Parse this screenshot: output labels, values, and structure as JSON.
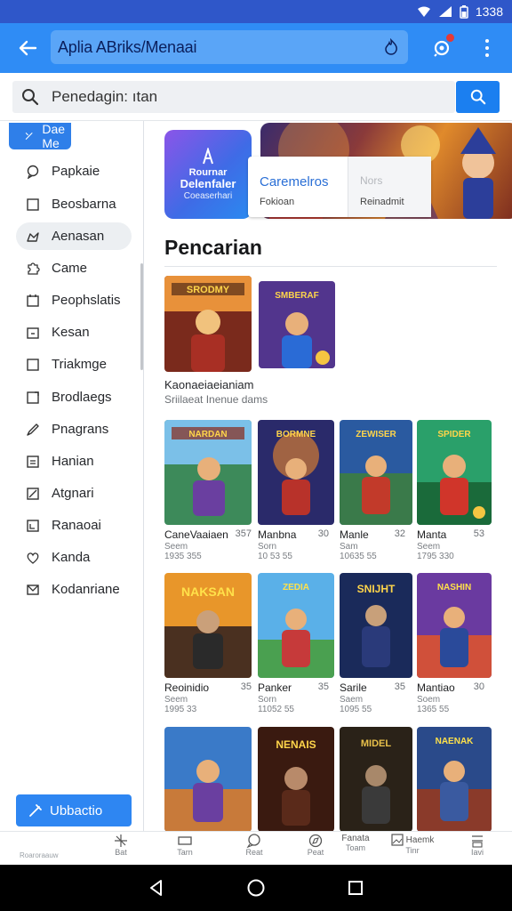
{
  "status_bar": {
    "time": "1338",
    "icons": [
      "wifi-icon",
      "signal-icon",
      "battery-icon"
    ]
  },
  "app_bar": {
    "title": "Aplia ABriks/Menaai",
    "icons": [
      "back-arrow-icon",
      "flame-icon",
      "notification-icon",
      "more-vert-icon"
    ]
  },
  "search": {
    "value": "Penedagin: ıtan",
    "placeholder": "Penedagin: ıtan"
  },
  "sidebar": {
    "top_label": "Dae Me",
    "items": [
      {
        "label": "Papkaie",
        "icon": "chat-bubble-icon"
      },
      {
        "label": "Beosbarna",
        "icon": "square-icon"
      },
      {
        "label": "Aenasan",
        "icon": "cloud-icon",
        "active": true
      },
      {
        "label": "Came",
        "icon": "puzzle-icon"
      },
      {
        "label": "Peophslatis",
        "icon": "calendar-icon"
      },
      {
        "label": "Kesan",
        "icon": "lock-icon"
      },
      {
        "label": "Triakmge",
        "icon": "checkbox-icon"
      },
      {
        "label": "Brodlaegs",
        "icon": "edit-square-icon"
      },
      {
        "label": "Pnagrans",
        "icon": "pen-icon"
      },
      {
        "label": "Hanian",
        "icon": "list-icon"
      },
      {
        "label": "Atgnari",
        "icon": "ruler-icon"
      },
      {
        "label": "Ranaoai",
        "icon": "box-icon"
      },
      {
        "label": "Kanda",
        "icon": "heart-icon"
      },
      {
        "label": "Kodanriane",
        "icon": "mail-icon"
      }
    ],
    "update_button": "Ubbactio"
  },
  "promo": {
    "app_line1": "Rournar",
    "app_line2": "Delenfaler",
    "app_line3": "Coeaserhari",
    "card": {
      "col1_title": "Caremelros",
      "col1_sub": "Fokioan",
      "col2_title": "Nors",
      "col2_sub": "Reinadmit"
    }
  },
  "section": {
    "title": "Pencarian"
  },
  "featured": {
    "caption": "Kaonaeiaeianiam",
    "subcaption": "Sriilaeat Inenue dams",
    "tiles": [
      {
        "title": "SRODMY",
        "accent": "#c0392b"
      },
      {
        "title": "SMBERAF",
        "accent": "#6a3fa0"
      }
    ]
  },
  "grid": [
    {
      "title": "NARDAN",
      "name": "CaneVaaiaen",
      "rating": "357",
      "sub": "Seem",
      "count": "1935 355"
    },
    {
      "title": "BORMNE",
      "name": "Manbna",
      "rating": "30",
      "sub": "Sorn",
      "count": "10 53 55"
    },
    {
      "title": "ZEWISER",
      "name": "Manle",
      "rating": "32",
      "sub": "Sam",
      "count": "10635 55"
    },
    {
      "title": "SPIDER",
      "name": "Manta",
      "rating": "53",
      "sub": "Seem",
      "count": "1795 330"
    },
    {
      "title": "NAKSAN",
      "name": "Reoinidio",
      "rating": "35",
      "sub": "Seem",
      "count": "1995 33"
    },
    {
      "title": "ZEDIA",
      "name": "Panker",
      "rating": "35",
      "sub": "Sorn",
      "count": "11052 55"
    },
    {
      "title": "SNIJHT",
      "name": "Sarile",
      "rating": "35",
      "sub": "Saem",
      "count": "1095 55"
    },
    {
      "title": "NASHIN",
      "name": "Mantiao",
      "rating": "30",
      "sub": "Soem",
      "count": "1365 55"
    },
    {
      "title": "",
      "name": "",
      "rating": "",
      "sub": "",
      "count": ""
    },
    {
      "title": "NENAIS",
      "name": "",
      "rating": "",
      "sub": "",
      "count": ""
    },
    {
      "title": "MIDEL",
      "name": "",
      "rating": "",
      "sub": "",
      "count": ""
    },
    {
      "title": "NAENAK",
      "name": "",
      "rating": "",
      "sub": "",
      "count": ""
    }
  ],
  "bottom_nav": {
    "first_label": "Roaroraauw",
    "items": [
      {
        "label": "Bat",
        "icon": "drone-icon"
      },
      {
        "label": "Tarn",
        "icon": "tablet-icon"
      },
      {
        "label": "Reat",
        "icon": "chat-icon"
      },
      {
        "label": "Peat",
        "icon": "compass-icon"
      },
      {
        "label": "Fanata",
        "sub": "Toam",
        "icon": "none"
      },
      {
        "label": "Haemk",
        "sub": "Tinr",
        "icon": "image-icon"
      },
      {
        "label": "Iavi",
        "icon": "menu-icon"
      }
    ]
  },
  "system_nav": {
    "icons": [
      "back-triangle-icon",
      "home-circle-icon",
      "recents-square-icon"
    ]
  },
  "colors": {
    "status_bar": "#2f57c9",
    "app_bar": "#2f8cf5",
    "accent": "#1b7ff0",
    "notification_dot": "#e53935"
  }
}
